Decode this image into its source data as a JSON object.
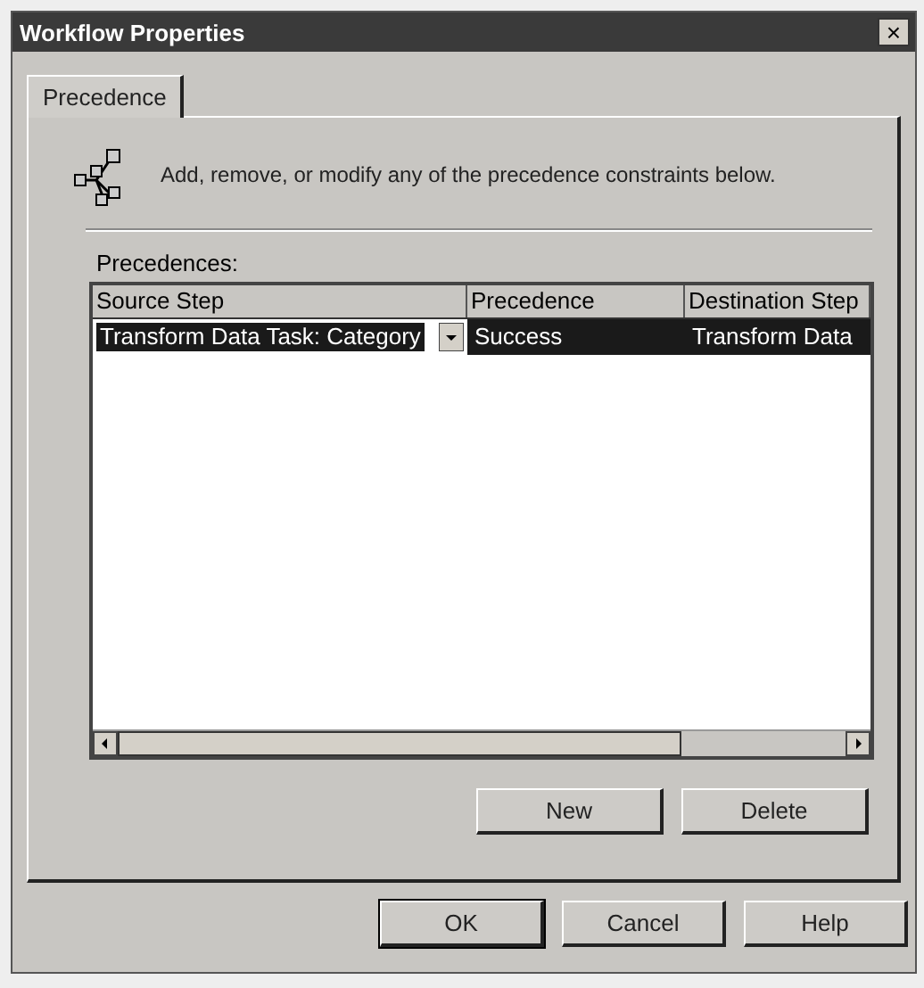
{
  "window": {
    "title": "Workflow Properties",
    "close": "×"
  },
  "tabs": [
    {
      "label": "Precedence",
      "selected": true
    }
  ],
  "intro": "Add, remove, or modify any of the precedence constraints below.",
  "table": {
    "label": "Precedences:",
    "columns": [
      "Source Step",
      "Precedence",
      "Destination Step"
    ],
    "rows": [
      {
        "cells": [
          "Transform Data Task: Category",
          "Success",
          "Transform Data"
        ],
        "selected": true
      }
    ]
  },
  "list_buttons": [
    "New",
    "Delete"
  ],
  "buttons": [
    {
      "label": "OK",
      "default": true
    },
    {
      "label": "Cancel",
      "default": false
    },
    {
      "label": "Help",
      "default": false
    }
  ]
}
